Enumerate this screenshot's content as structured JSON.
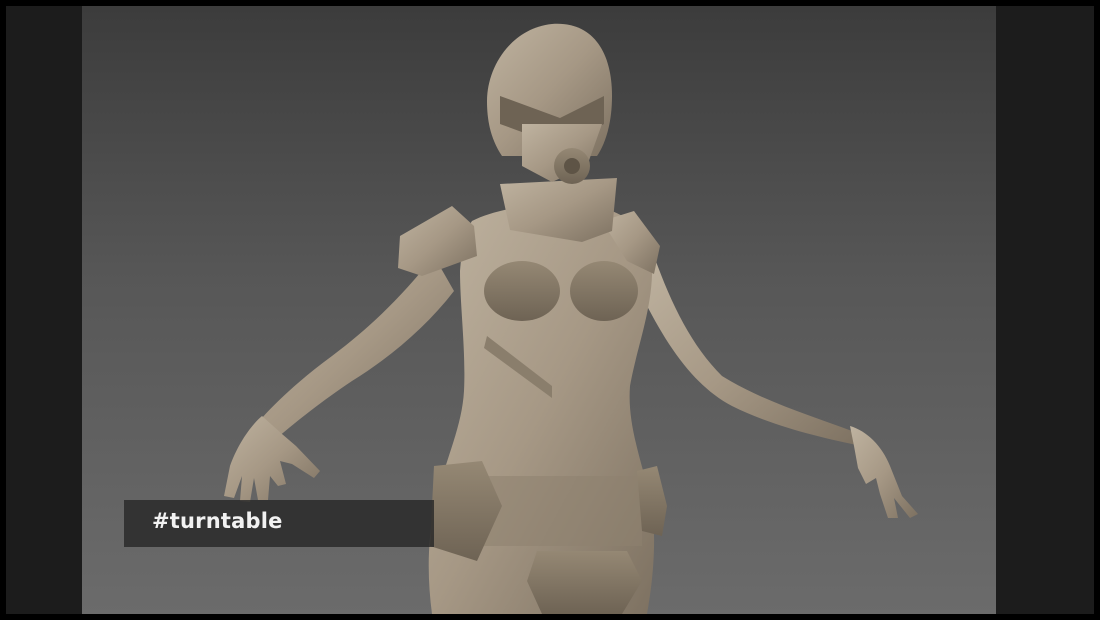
{
  "video": {
    "caption": "#turntable",
    "subject": "sculpted-figure-model"
  },
  "colors": {
    "frame": "#000000",
    "pillarbox": "#1c1c1c",
    "background_top": "#3c3c3c",
    "background_bottom": "#6b6b6b",
    "clay": "#a89a86",
    "caption_bg": "#282828",
    "caption_text": "#f2f2f2"
  }
}
